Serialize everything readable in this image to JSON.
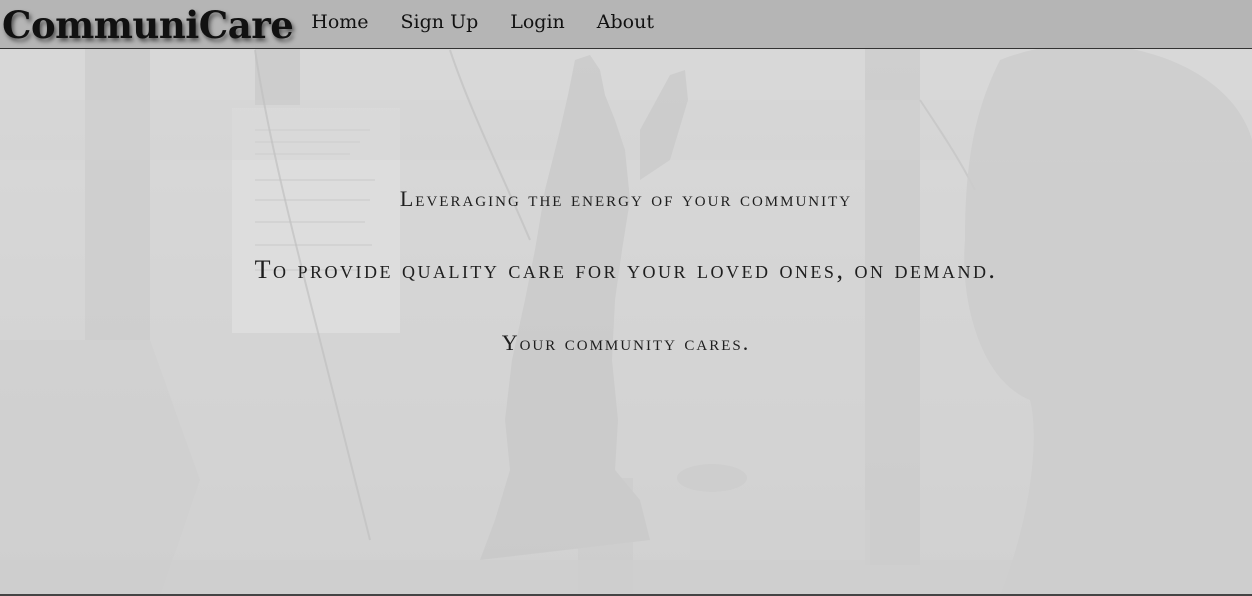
{
  "header": {
    "brand": "CommuniCare",
    "nav": [
      {
        "label": "Home"
      },
      {
        "label": "Sign Up"
      },
      {
        "label": "Login"
      },
      {
        "label": "About"
      }
    ]
  },
  "hero": {
    "line1": "Leveraging the energy of your community",
    "line2": "To provide quality care for your loved ones, on demand.",
    "line3": "Your community cares."
  },
  "colors": {
    "navbar": "#b2b2b2",
    "text": "#1e1e1e",
    "background": "#c9c9c9"
  }
}
